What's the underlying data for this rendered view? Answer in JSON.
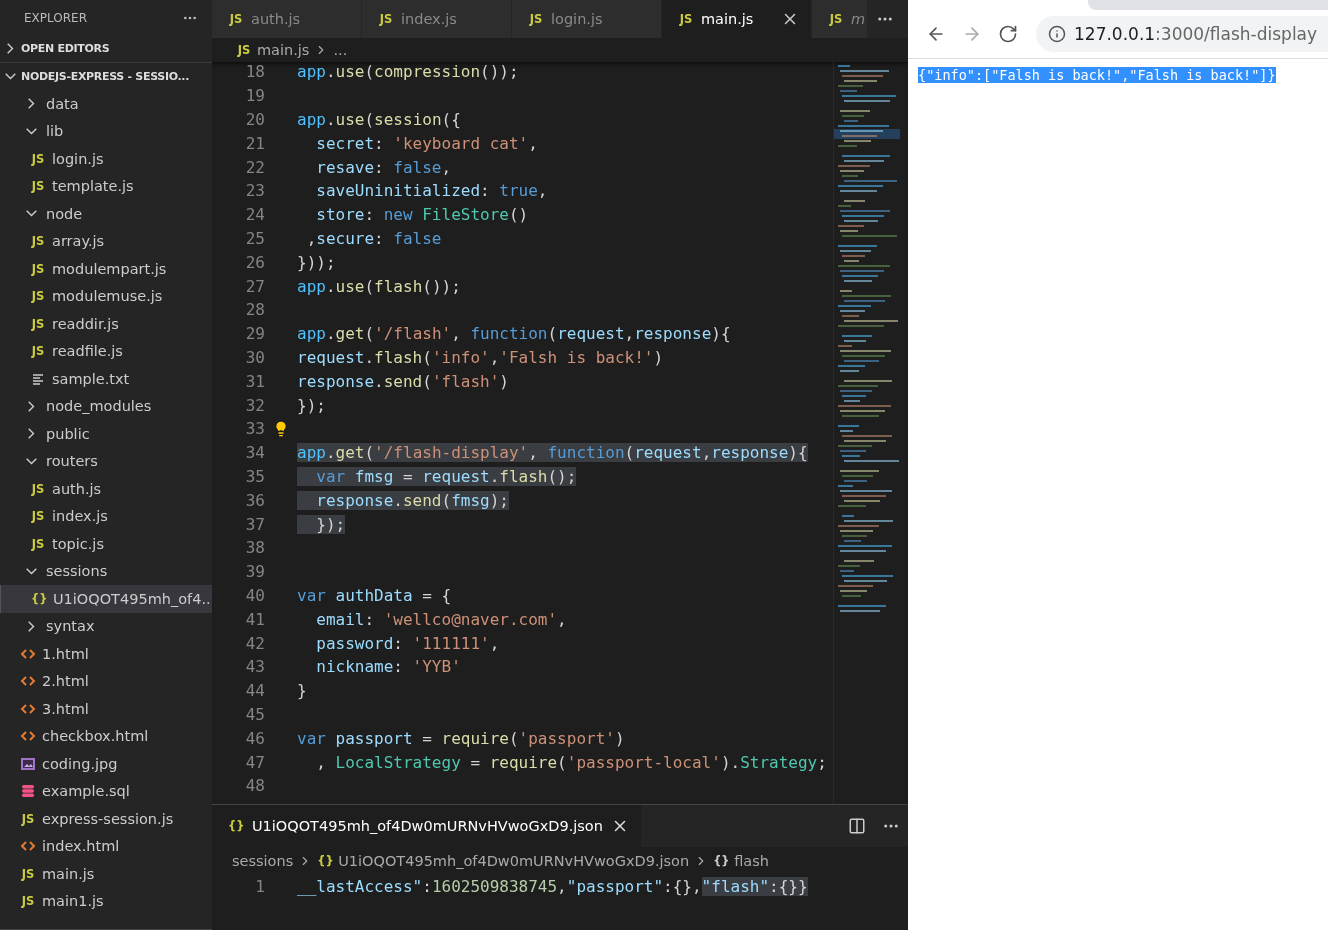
{
  "sidebar": {
    "title": "EXPLORER",
    "sections": [
      {
        "title": "OPEN EDITORS",
        "expanded": false
      },
      {
        "title": "NODEJS-EXPRESS - SESSIO...",
        "expanded": true,
        "items": [
          {
            "name": "data",
            "kind": "folder",
            "expanded": false,
            "selected": false
          },
          {
            "name": "lib",
            "kind": "folder",
            "expanded": true,
            "selected": false,
            "children": [
              {
                "name": "login.js",
                "kind": "js",
                "icon_text": "JS",
                "selected": false
              },
              {
                "name": "template.js",
                "kind": "js",
                "icon_text": "JS",
                "selected": false
              }
            ]
          },
          {
            "name": "node",
            "kind": "folder",
            "expanded": true,
            "selected": false,
            "children": [
              {
                "name": "array.js",
                "kind": "js",
                "icon_text": "JS",
                "selected": false
              },
              {
                "name": "modulempart.js",
                "kind": "js",
                "icon_text": "JS",
                "selected": false
              },
              {
                "name": "modulemuse.js",
                "kind": "js",
                "icon_text": "JS",
                "selected": false
              },
              {
                "name": "readdir.js",
                "kind": "js",
                "icon_text": "JS",
                "selected": false
              },
              {
                "name": "readfile.js",
                "kind": "js",
                "icon_text": "JS",
                "selected": false
              },
              {
                "name": "sample.txt",
                "kind": "txt",
                "selected": false
              }
            ]
          },
          {
            "name": "node_modules",
            "kind": "folder",
            "expanded": false,
            "selected": false
          },
          {
            "name": "public",
            "kind": "folder",
            "expanded": false,
            "selected": false
          },
          {
            "name": "routers",
            "kind": "folder",
            "expanded": true,
            "selected": false,
            "children": [
              {
                "name": "auth.js",
                "kind": "js",
                "icon_text": "JS",
                "selected": false
              },
              {
                "name": "index.js",
                "kind": "js",
                "icon_text": "JS",
                "selected": false
              },
              {
                "name": "topic.js",
                "kind": "js",
                "icon_text": "JS",
                "selected": false
              }
            ]
          },
          {
            "name": "sessions",
            "kind": "folder",
            "expanded": true,
            "selected": false,
            "children": [
              {
                "name": "U1iOQOT495mh_of4...",
                "kind": "json",
                "icon_text": "{}",
                "selected": true
              }
            ]
          },
          {
            "name": "syntax",
            "kind": "folder",
            "expanded": false,
            "selected": false
          },
          {
            "name": "1.html",
            "kind": "html",
            "selected": false
          },
          {
            "name": "2.html",
            "kind": "html",
            "selected": false
          },
          {
            "name": "3.html",
            "kind": "html",
            "selected": false
          },
          {
            "name": "checkbox.html",
            "kind": "html",
            "selected": false
          },
          {
            "name": "coding.jpg",
            "kind": "image",
            "selected": false
          },
          {
            "name": "example.sql",
            "kind": "sql",
            "selected": false
          },
          {
            "name": "express-session.js",
            "kind": "js",
            "icon_text": "JS",
            "selected": false
          },
          {
            "name": "index.html",
            "kind": "html",
            "selected": false
          },
          {
            "name": "main.js",
            "kind": "js",
            "icon_text": "JS",
            "selected": false
          },
          {
            "name": "main1.js",
            "kind": "js",
            "icon_text": "JS",
            "selected": false
          }
        ]
      }
    ]
  },
  "editor": {
    "tabs": [
      {
        "label": "auth.js",
        "icon_text": "JS",
        "selected": false,
        "preview": false
      },
      {
        "label": "index.js",
        "icon_text": "JS",
        "selected": false,
        "preview": false
      },
      {
        "label": "login.js",
        "icon_text": "JS",
        "selected": false,
        "preview": false
      },
      {
        "label": "main.js",
        "icon_text": "JS",
        "selected": true,
        "preview": false
      },
      {
        "label": "m",
        "icon_text": "JS",
        "selected": false,
        "preview": true
      }
    ],
    "breadcrumb": {
      "icon_text": "JS",
      "file": "main.js",
      "rest": "..."
    },
    "lines": [
      {
        "number": "18",
        "selected": false,
        "lightbulb": false,
        "tokens": [
          {
            "text": "app",
            "kind": "obj"
          },
          {
            "text": ".",
            "kind": "plain"
          },
          {
            "text": "use",
            "kind": "fn"
          },
          {
            "text": "(",
            "kind": "plain"
          },
          {
            "text": "compression",
            "kind": "fn"
          },
          {
            "text": "());",
            "kind": "plain"
          }
        ]
      },
      {
        "number": "19",
        "selected": false,
        "lightbulb": false
      },
      {
        "number": "20",
        "selected": false,
        "lightbulb": false,
        "tokens": [
          {
            "text": "app",
            "kind": "obj"
          },
          {
            "text": ".",
            "kind": "plain"
          },
          {
            "text": "use",
            "kind": "fn"
          },
          {
            "text": "(",
            "kind": "plain"
          },
          {
            "text": "session",
            "kind": "fn"
          },
          {
            "text": "({",
            "kind": "plain"
          }
        ]
      },
      {
        "number": "21",
        "selected": false,
        "lightbulb": false,
        "tokens": [
          {
            "text": "  secret",
            "kind": "var"
          },
          {
            "text": ": ",
            "kind": "plain"
          },
          {
            "text": "'keyboard cat'",
            "kind": "str"
          },
          {
            "text": ",",
            "kind": "plain"
          }
        ]
      },
      {
        "number": "22",
        "selected": false,
        "lightbulb": false,
        "tokens": [
          {
            "text": "  resave",
            "kind": "var"
          },
          {
            "text": ": ",
            "kind": "plain"
          },
          {
            "text": "false",
            "kind": "kw"
          },
          {
            "text": ",",
            "kind": "plain"
          }
        ]
      },
      {
        "number": "23",
        "selected": false,
        "lightbulb": false,
        "tokens": [
          {
            "text": "  saveUninitialized",
            "kind": "var"
          },
          {
            "text": ": ",
            "kind": "plain"
          },
          {
            "text": "true",
            "kind": "kw"
          },
          {
            "text": ",",
            "kind": "plain"
          }
        ]
      },
      {
        "number": "24",
        "selected": false,
        "lightbulb": false,
        "tokens": [
          {
            "text": "  store",
            "kind": "var"
          },
          {
            "text": ": ",
            "kind": "plain"
          },
          {
            "text": "new ",
            "kind": "kw"
          },
          {
            "text": "FileStore",
            "kind": "cls"
          },
          {
            "text": "()",
            "kind": "plain"
          }
        ]
      },
      {
        "number": "25",
        "selected": false,
        "lightbulb": false,
        "tokens": [
          {
            "text": " ,",
            "kind": "plain"
          },
          {
            "text": "secure",
            "kind": "var"
          },
          {
            "text": ": ",
            "kind": "plain"
          },
          {
            "text": "false",
            "kind": "kw"
          }
        ]
      },
      {
        "number": "26",
        "selected": false,
        "lightbulb": false,
        "tokens": [
          {
            "text": "}));",
            "kind": "plain"
          }
        ]
      },
      {
        "number": "27",
        "selected": false,
        "lightbulb": false,
        "tokens": [
          {
            "text": "app",
            "kind": "obj"
          },
          {
            "text": ".",
            "kind": "plain"
          },
          {
            "text": "use",
            "kind": "fn"
          },
          {
            "text": "(",
            "kind": "plain"
          },
          {
            "text": "flash",
            "kind": "fn"
          },
          {
            "text": "());",
            "kind": "plain"
          }
        ]
      },
      {
        "number": "28",
        "selected": false,
        "lightbulb": false
      },
      {
        "number": "29",
        "selected": false,
        "lightbulb": false,
        "tokens": [
          {
            "text": "app",
            "kind": "obj"
          },
          {
            "text": ".",
            "kind": "plain"
          },
          {
            "text": "get",
            "kind": "fn"
          },
          {
            "text": "(",
            "kind": "plain"
          },
          {
            "text": "'/flash'",
            "kind": "str"
          },
          {
            "text": ", ",
            "kind": "plain"
          },
          {
            "text": "function",
            "kind": "kw"
          },
          {
            "text": "(",
            "kind": "plain"
          },
          {
            "text": "request",
            "kind": "var"
          },
          {
            "text": ",",
            "kind": "plain"
          },
          {
            "text": "response",
            "kind": "var"
          },
          {
            "text": "){",
            "kind": "plain"
          }
        ]
      },
      {
        "number": "30",
        "selected": false,
        "lightbulb": false,
        "tokens": [
          {
            "text": "request",
            "kind": "var"
          },
          {
            "text": ".",
            "kind": "plain"
          },
          {
            "text": "flash",
            "kind": "fn"
          },
          {
            "text": "(",
            "kind": "plain"
          },
          {
            "text": "'info'",
            "kind": "str"
          },
          {
            "text": ",",
            "kind": "plain"
          },
          {
            "text": "'Falsh is back!'",
            "kind": "str"
          },
          {
            "text": ")",
            "kind": "plain"
          }
        ]
      },
      {
        "number": "31",
        "selected": false,
        "lightbulb": false,
        "tokens": [
          {
            "text": "response",
            "kind": "var"
          },
          {
            "text": ".",
            "kind": "plain"
          },
          {
            "text": "send",
            "kind": "fn"
          },
          {
            "text": "(",
            "kind": "plain"
          },
          {
            "text": "'flash'",
            "kind": "str"
          },
          {
            "text": ")",
            "kind": "plain"
          }
        ]
      },
      {
        "number": "32",
        "selected": false,
        "lightbulb": false,
        "tokens": [
          {
            "text": "});",
            "kind": "plain"
          }
        ]
      },
      {
        "number": "33",
        "selected": false,
        "lightbulb": true
      },
      {
        "number": "34",
        "selected": true,
        "lightbulb": false,
        "tokens": [
          {
            "text": "app",
            "kind": "obj"
          },
          {
            "text": ".",
            "kind": "plain"
          },
          {
            "text": "get",
            "kind": "fn"
          },
          {
            "text": "(",
            "kind": "plain"
          },
          {
            "text": "'/flash-display'",
            "kind": "str"
          },
          {
            "text": ", ",
            "kind": "plain"
          },
          {
            "text": "function",
            "kind": "kw"
          },
          {
            "text": "(",
            "kind": "plain"
          },
          {
            "text": "request",
            "kind": "var"
          },
          {
            "text": ",",
            "kind": "plain"
          },
          {
            "text": "response",
            "kind": "var"
          },
          {
            "text": "){",
            "kind": "plain"
          }
        ]
      },
      {
        "number": "35",
        "selected": true,
        "lightbulb": false,
        "tokens": [
          {
            "text": "  var ",
            "kind": "kw"
          },
          {
            "text": "fmsg",
            "kind": "var"
          },
          {
            "text": " = ",
            "kind": "plain"
          },
          {
            "text": "request",
            "kind": "var"
          },
          {
            "text": ".",
            "kind": "plain"
          },
          {
            "text": "flash",
            "kind": "fn"
          },
          {
            "text": "();",
            "kind": "plain"
          }
        ]
      },
      {
        "number": "36",
        "selected": true,
        "lightbulb": false,
        "tokens": [
          {
            "text": "  response",
            "kind": "var"
          },
          {
            "text": ".",
            "kind": "plain"
          },
          {
            "text": "send",
            "kind": "fn"
          },
          {
            "text": "(",
            "kind": "plain"
          },
          {
            "text": "fmsg",
            "kind": "var"
          },
          {
            "text": ");",
            "kind": "plain"
          }
        ]
      },
      {
        "number": "37",
        "selected": true,
        "lightbulb": false,
        "tokens": [
          {
            "text": "  });",
            "kind": "plain"
          }
        ]
      },
      {
        "number": "38",
        "selected": false,
        "lightbulb": false
      },
      {
        "number": "39",
        "selected": false,
        "lightbulb": false
      },
      {
        "number": "40",
        "selected": false,
        "lightbulb": false,
        "tokens": [
          {
            "text": "var ",
            "kind": "kw"
          },
          {
            "text": "authData",
            "kind": "var"
          },
          {
            "text": " = {",
            "kind": "plain"
          }
        ]
      },
      {
        "number": "41",
        "selected": false,
        "lightbulb": false,
        "tokens": [
          {
            "text": "  email",
            "kind": "var"
          },
          {
            "text": ": ",
            "kind": "plain"
          },
          {
            "text": "'wellco@naver.com'",
            "kind": "str"
          },
          {
            "text": ",",
            "kind": "plain"
          }
        ]
      },
      {
        "number": "42",
        "selected": false,
        "lightbulb": false,
        "tokens": [
          {
            "text": "  password",
            "kind": "var"
          },
          {
            "text": ": ",
            "kind": "plain"
          },
          {
            "text": "'111111'",
            "kind": "str"
          },
          {
            "text": ",",
            "kind": "plain"
          }
        ]
      },
      {
        "number": "43",
        "selected": false,
        "lightbulb": false,
        "tokens": [
          {
            "text": "  nickname",
            "kind": "var"
          },
          {
            "text": ": ",
            "kind": "plain"
          },
          {
            "text": "'YYB'",
            "kind": "str"
          }
        ]
      },
      {
        "number": "44",
        "selected": false,
        "lightbulb": false,
        "tokens": [
          {
            "text": "}",
            "kind": "plain"
          }
        ]
      },
      {
        "number": "45",
        "selected": false,
        "lightbulb": false
      },
      {
        "number": "46",
        "selected": false,
        "lightbulb": false,
        "tokens": [
          {
            "text": "var ",
            "kind": "kw"
          },
          {
            "text": "passport",
            "kind": "var"
          },
          {
            "text": " = ",
            "kind": "plain"
          },
          {
            "text": "require",
            "kind": "fn"
          },
          {
            "text": "(",
            "kind": "plain"
          },
          {
            "text": "'passport'",
            "kind": "str"
          },
          {
            "text": ")",
            "kind": "plain"
          }
        ]
      },
      {
        "number": "47",
        "selected": false,
        "lightbulb": false,
        "tokens": [
          {
            "text": "  , ",
            "kind": "plain"
          },
          {
            "text": "LocalStrategy",
            "kind": "cls"
          },
          {
            "text": " = ",
            "kind": "plain"
          },
          {
            "text": "require",
            "kind": "fn"
          },
          {
            "text": "(",
            "kind": "plain"
          },
          {
            "text": "'passport-local'",
            "kind": "str"
          },
          {
            "text": ").",
            "kind": "plain"
          },
          {
            "text": "Strategy",
            "kind": "cls"
          },
          {
            "text": ";",
            "kind": "plain"
          }
        ]
      },
      {
        "number": "48",
        "selected": false,
        "lightbulb": false
      }
    ]
  },
  "panel": {
    "tab": {
      "icon_text": "{}",
      "label": "U1iOQOT495mh_of4Dw0mURNvHVwoGxD9.json"
    },
    "breadcrumb": [
      {
        "label": "sessions"
      },
      {
        "icon_text": "{}",
        "label": "U1iOQOT495mh_of4Dw0mURNvHVwoGxD9.json"
      },
      {
        "icon_text": "{}",
        "label": "flash"
      }
    ],
    "lines": [
      {
        "number": "1",
        "tokens": [
          {
            "text": "__lastAccess\"",
            "kind": "var",
            "selected": false
          },
          {
            "text": ":",
            "kind": "plain",
            "selected": false
          },
          {
            "text": "1602509838745",
            "kind": "num",
            "selected": false
          },
          {
            "text": ",",
            "kind": "plain",
            "selected": false
          },
          {
            "text": "\"passport\"",
            "kind": "var",
            "selected": false
          },
          {
            "text": ":{},",
            "kind": "plain",
            "selected": false
          },
          {
            "text": "\"flash\"",
            "kind": "var",
            "selected": true
          },
          {
            "text": ":{}}",
            "kind": "plain",
            "selected": true
          }
        ]
      }
    ]
  },
  "browser": {
    "url_host": "127.0.0.1",
    "url_path": ":3000/flash-display",
    "forward_disabled": true,
    "content": {
      "text": "{\"info\":[\"Falsh is back!\",\"Falsh is back!\"]}",
      "selected": true
    }
  }
}
